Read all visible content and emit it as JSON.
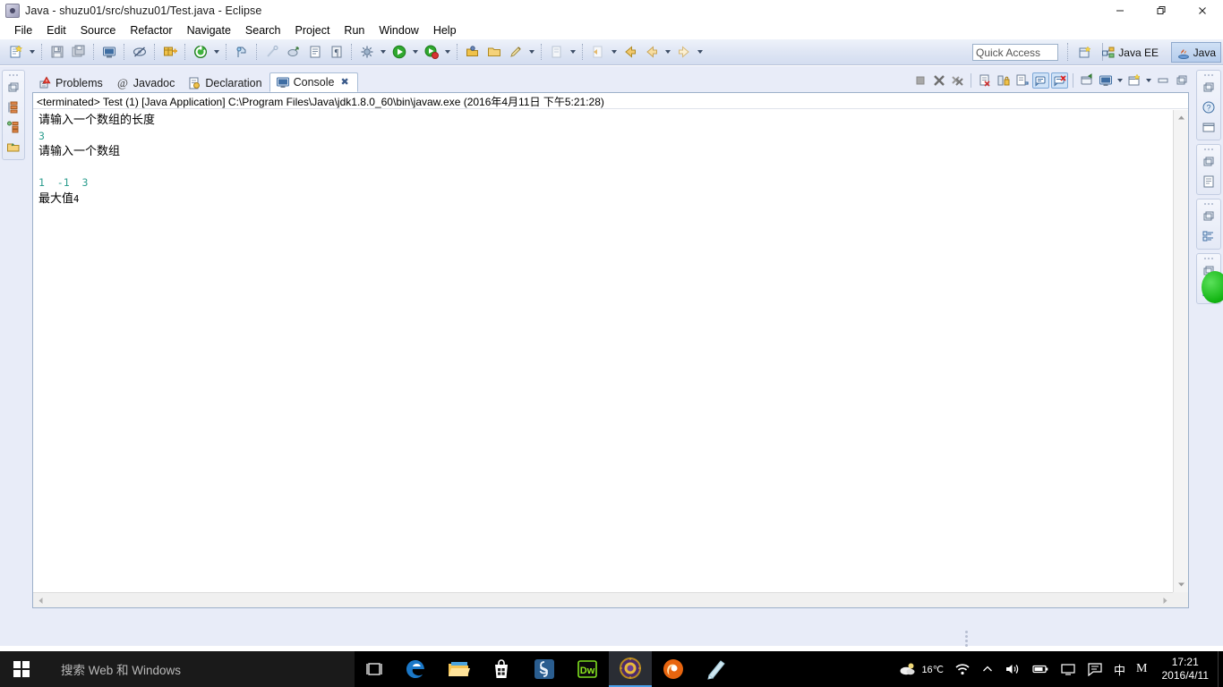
{
  "window": {
    "title": "Java - shuzu01/src/shuzu01/Test.java - Eclipse",
    "app_icon": "eclipse-icon",
    "minimize": "–",
    "maximize": "❐",
    "close": "✕"
  },
  "menubar": {
    "items": [
      {
        "label": "File"
      },
      {
        "label": "Edit"
      },
      {
        "label": "Source"
      },
      {
        "label": "Refactor"
      },
      {
        "label": "Navigate"
      },
      {
        "label": "Search"
      },
      {
        "label": "Project"
      },
      {
        "label": "Run"
      },
      {
        "label": "Window"
      },
      {
        "label": "Help"
      }
    ]
  },
  "toolbar": {
    "quick_access_placeholder": "Quick Access",
    "quick_access_value": "",
    "perspectives": [
      {
        "label": "Java EE",
        "icon": "javaee-perspective-icon",
        "active": false
      },
      {
        "label": "Java",
        "icon": "java-perspective-icon",
        "active": true
      }
    ],
    "open_perspective_icon": "open-perspective-icon",
    "buttons": [
      {
        "name": "new-wizard-icon"
      },
      {
        "name": "save-icon"
      },
      {
        "name": "save-all-icon"
      },
      {
        "name": "print-icon"
      },
      {
        "name": "toggle-mark-occurrences-icon"
      },
      {
        "name": "new-java-package-icon"
      },
      {
        "name": "new-java-class-icon"
      },
      {
        "name": "open-type-icon"
      },
      {
        "name": "search-icon"
      },
      {
        "name": "link-icon"
      },
      {
        "name": "show-whitespace-icon"
      },
      {
        "name": "pilcrow-icon"
      },
      {
        "name": "debug-icon"
      },
      {
        "name": "run-icon"
      },
      {
        "name": "coverage-icon"
      },
      {
        "name": "external-tools-icon"
      },
      {
        "name": "open-folder-icon"
      },
      {
        "name": "pencil-icon"
      },
      {
        "name": "next-annotation-icon"
      },
      {
        "name": "previous-edit-icon"
      },
      {
        "name": "back-icon"
      },
      {
        "name": "forward-icon"
      }
    ]
  },
  "left_fastview": {
    "groups": [
      {
        "items": [
          {
            "name": "package-explorer-icon"
          },
          {
            "name": "outline-icon"
          },
          {
            "name": "type-hierarchy-icon"
          },
          {
            "name": "project-explorer-icon"
          }
        ]
      }
    ]
  },
  "right_fastview": {
    "groups": [
      {
        "items": [
          {
            "name": "restore-icon"
          },
          {
            "name": "javadoc-help-icon"
          },
          {
            "name": "minimized-view-icon"
          }
        ]
      },
      {
        "items": [
          {
            "name": "restore-icon"
          },
          {
            "name": "task-list-icon"
          }
        ]
      },
      {
        "items": [
          {
            "name": "restore-icon"
          },
          {
            "name": "outline-view-icon"
          }
        ]
      },
      {
        "items": [
          {
            "name": "restore-icon"
          },
          {
            "name": "template-view-icon"
          }
        ]
      }
    ]
  },
  "view_tabs": [
    {
      "label": "Problems",
      "icon": "problems-icon",
      "active": false,
      "closable": false
    },
    {
      "label": "Javadoc",
      "icon": "javadoc-icon",
      "active": false,
      "closable": false
    },
    {
      "label": "Declaration",
      "icon": "declaration-icon",
      "active": false,
      "closable": false
    },
    {
      "label": "Console",
      "icon": "console-icon",
      "active": true,
      "closable": true,
      "close_glyph": "✖"
    }
  ],
  "view_toolbar": [
    {
      "name": "terminate-icon",
      "enabled": false,
      "toggled": false
    },
    {
      "name": "remove-launch-icon",
      "enabled": false,
      "toggled": false
    },
    {
      "name": "remove-all-terminated-icon",
      "enabled": false,
      "toggled": false
    },
    {
      "name": "clear-console-icon",
      "enabled": true,
      "toggled": false
    },
    {
      "name": "scroll-lock-icon",
      "enabled": true,
      "toggled": false
    },
    {
      "name": "word-wrap-icon",
      "enabled": true,
      "toggled": false
    },
    {
      "name": "show-console-on-output-icon",
      "enabled": true,
      "toggled": true
    },
    {
      "name": "show-console-on-error-icon",
      "enabled": true,
      "toggled": true
    },
    {
      "name": "pin-console-icon",
      "enabled": true,
      "toggled": false
    },
    {
      "name": "display-selected-console-icon",
      "enabled": true,
      "toggled": false
    },
    {
      "name": "open-console-icon",
      "enabled": true,
      "toggled": false
    },
    {
      "name": "minimize-view-icon",
      "enabled": true,
      "toggled": false
    },
    {
      "name": "maximize-view-icon",
      "enabled": true,
      "toggled": false
    }
  ],
  "console": {
    "header": "<terminated> Test (1) [Java Application] C:\\Program Files\\Java\\jdk1.8.0_60\\bin\\javaw.exe (2016年4月11日 下午5:21:28)",
    "input_color": "#2e9e8f",
    "lines": [
      {
        "text": "请输入一个数组的长度",
        "kind": "output"
      },
      {
        "text": "3",
        "kind": "input"
      },
      {
        "text": "请输入一个数组",
        "kind": "output"
      },
      {
        "text": "",
        "kind": "blank"
      },
      {
        "text": "1  -1  3",
        "kind": "input"
      },
      {
        "text": "最大值",
        "suffix": "4",
        "kind": "output"
      }
    ]
  },
  "scrollbars": {
    "vertical_up": "▲",
    "vertical_down": "▼",
    "horizontal_left": "◀",
    "horizontal_right": "▶"
  },
  "taskbar": {
    "start_icon": "windows-logo-icon",
    "search_placeholder": "搜索 Web 和 Windows",
    "task_view_icon": "task-view-icon",
    "apps": [
      {
        "name": "edge-icon",
        "label": "Microsoft Edge",
        "running": false
      },
      {
        "name": "file-explorer-icon",
        "label": "File Explorer",
        "running": false
      },
      {
        "name": "microsoft-store-icon",
        "label": "Store",
        "running": false
      },
      {
        "name": "skype-icon",
        "label": "Skype",
        "running": false
      },
      {
        "name": "dreamweaver-icon",
        "label": "Dw",
        "running": false
      },
      {
        "name": "eclipse-icon",
        "label": "Eclipse",
        "running": true
      },
      {
        "name": "firefox-icon",
        "label": "Firefox",
        "running": false
      },
      {
        "name": "notes-icon",
        "label": "Notes",
        "running": false
      }
    ],
    "tray": [
      {
        "name": "weather-icon",
        "label": "16℃"
      },
      {
        "name": "wifi-icon",
        "label": ""
      },
      {
        "name": "show-hidden-icons-icon",
        "label": "∧"
      },
      {
        "name": "volume-icon",
        "label": ""
      },
      {
        "name": "battery-icon",
        "label": ""
      },
      {
        "name": "display-icon",
        "label": ""
      },
      {
        "name": "action-center-icon",
        "label": ""
      },
      {
        "name": "ime-mode-icon",
        "label": "中"
      },
      {
        "name": "ime-logo-icon",
        "label": "M"
      }
    ],
    "clock": {
      "time": "17:21",
      "date": "2016/4/11"
    }
  }
}
